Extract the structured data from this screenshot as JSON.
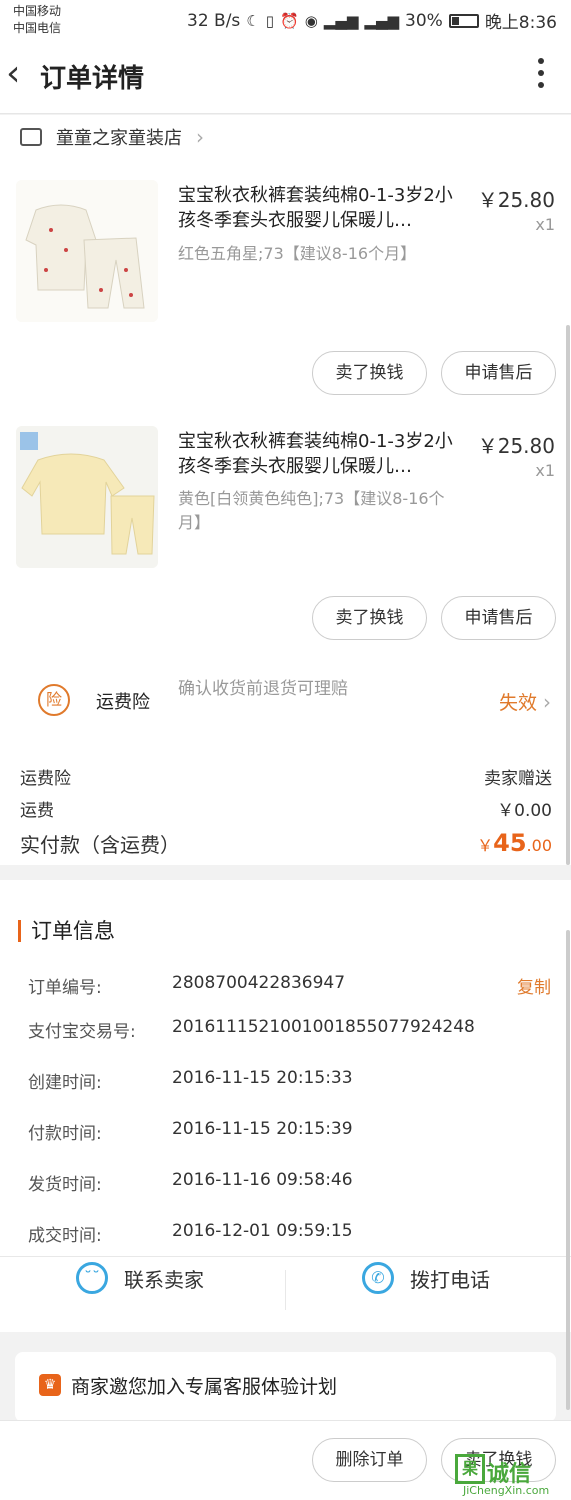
{
  "status_bar": {
    "carrier_1": "中国移动",
    "carrier_2": "中国电信",
    "speed": "32 B/s",
    "network": "4G 2G",
    "battery": "30%",
    "time": "晚上8:36"
  },
  "header": {
    "title": "订单详情"
  },
  "shop": {
    "name": "童童之家童装店"
  },
  "items": [
    {
      "title": "宝宝秋衣秋裤套装纯棉0-1-3岁2小孩冬季套头衣服婴儿保暖儿…",
      "sku": "红色五角星;73【建议8-16个月】",
      "price": "￥25.80",
      "qty": "x1",
      "sell_label": "卖了换钱",
      "after_sale_label": "申请售后"
    },
    {
      "title": "宝宝秋衣秋裤套装纯棉0-1-3岁2小孩冬季套头衣服婴儿保暖儿…",
      "sku": "黄色[白领黄色纯色];73【建议8-16个月】",
      "price": "￥25.80",
      "qty": "x1",
      "sell_label": "卖了换钱",
      "after_sale_label": "申请售后"
    }
  ],
  "insurance": {
    "badge": "险",
    "label": "运费险",
    "desc": "确认收货前退货可理赔",
    "status": "失效"
  },
  "summary": {
    "insurance_label": "运费险",
    "insurance_value": "卖家赠送",
    "shipping_label": "运费",
    "shipping_value": "￥0.00",
    "total_label": "实付款（含运费）",
    "total_symbol": "￥",
    "total_int": "45",
    "total_dec": ".00"
  },
  "order_info": {
    "title": "订单信息",
    "copy_label": "复制",
    "rows": [
      {
        "label": "订单编号:",
        "value": "2808700422836947"
      },
      {
        "label": "支付宝交易号:",
        "value": "2016111521001001855077924248"
      },
      {
        "label": "创建时间:",
        "value": "2016-11-15 20:15:33"
      },
      {
        "label": "付款时间:",
        "value": "2016-11-15 20:15:39"
      },
      {
        "label": "发货时间:",
        "value": "2016-11-16 09:58:46"
      },
      {
        "label": "成交时间:",
        "value": "2016-12-01 09:59:15"
      }
    ]
  },
  "contact": {
    "seller_label": "联系卖家",
    "phone_label": "拨打电话"
  },
  "promo": {
    "text": "商家邀您加入专属客服体验计划"
  },
  "bottom": {
    "delete_label": "删除订单",
    "sell_label": "卖了换钱"
  },
  "watermark": {
    "box": "果",
    "text": "诚信",
    "url": "JiChengXin.com"
  }
}
